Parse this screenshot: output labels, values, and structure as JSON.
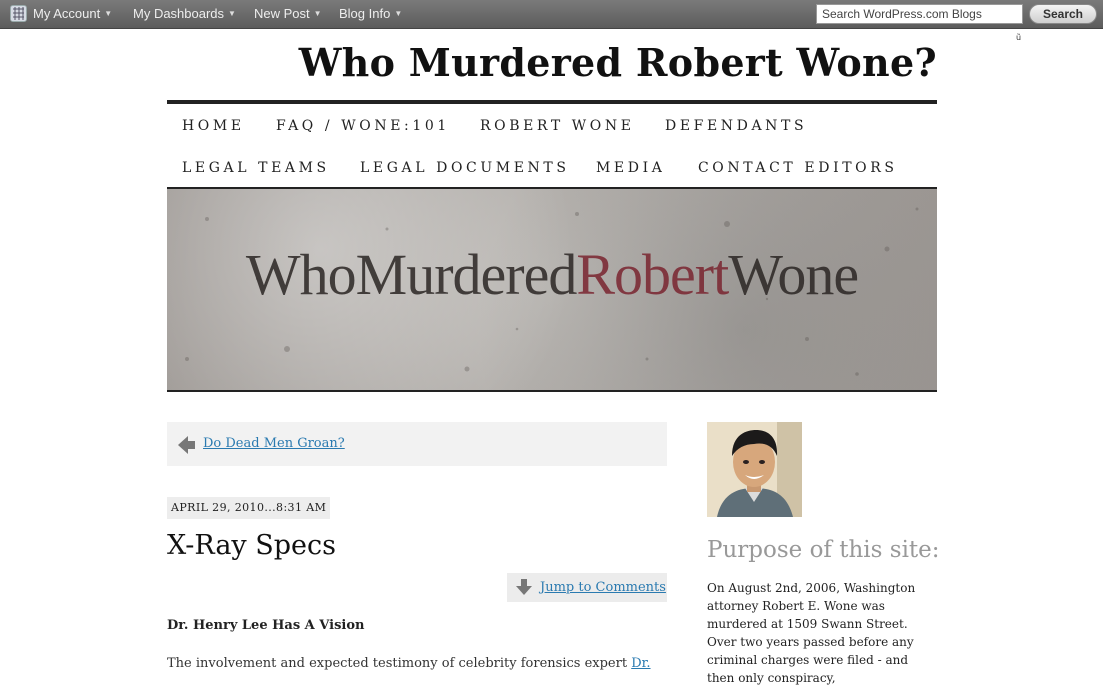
{
  "adminbar": {
    "menus": [
      "My Account",
      "My Dashboards",
      "New Post",
      "Blog Info"
    ],
    "search_placeholder": "Search WordPress.com Blogs",
    "search_button": "Search"
  },
  "site": {
    "title": "Who Murdered Robert Wone?"
  },
  "nav": {
    "row1": [
      "HOME",
      "FAQ / WONE:101",
      "ROBERT WONE",
      "DEFENDANTS"
    ],
    "row2": [
      "LEGAL TEAMS",
      "LEGAL DOCUMENTS",
      "MEDIA",
      "CONTACT EDITORS"
    ]
  },
  "banner": {
    "part1": "WhoMurdered",
    "part2": "Robert",
    "part3": "Wone",
    "color_dark": "#2b2624",
    "color_red": "#7a2530"
  },
  "post": {
    "prev_link": "Do Dead Men Groan?",
    "date": "APRIL 29, 2010...8:31 AM",
    "title": "X-Ray Specs",
    "jump_link": "Jump to Comments",
    "subhead": "Dr. Henry Lee Has A Vision",
    "body_text": "The involvement and expected testimony of celebrity forensics expert ",
    "body_link": "Dr."
  },
  "sidebar": {
    "title": "Purpose of this site:",
    "text": "On August 2nd, 2006, Washington attorney Robert E. Wone was murdered at 1509 Swann Street. Over two years passed before any criminal charges were filed - and then only conspiracy,"
  },
  "colors": {
    "link": "#2a7ab0",
    "adminbar": "#6a6a6a"
  }
}
